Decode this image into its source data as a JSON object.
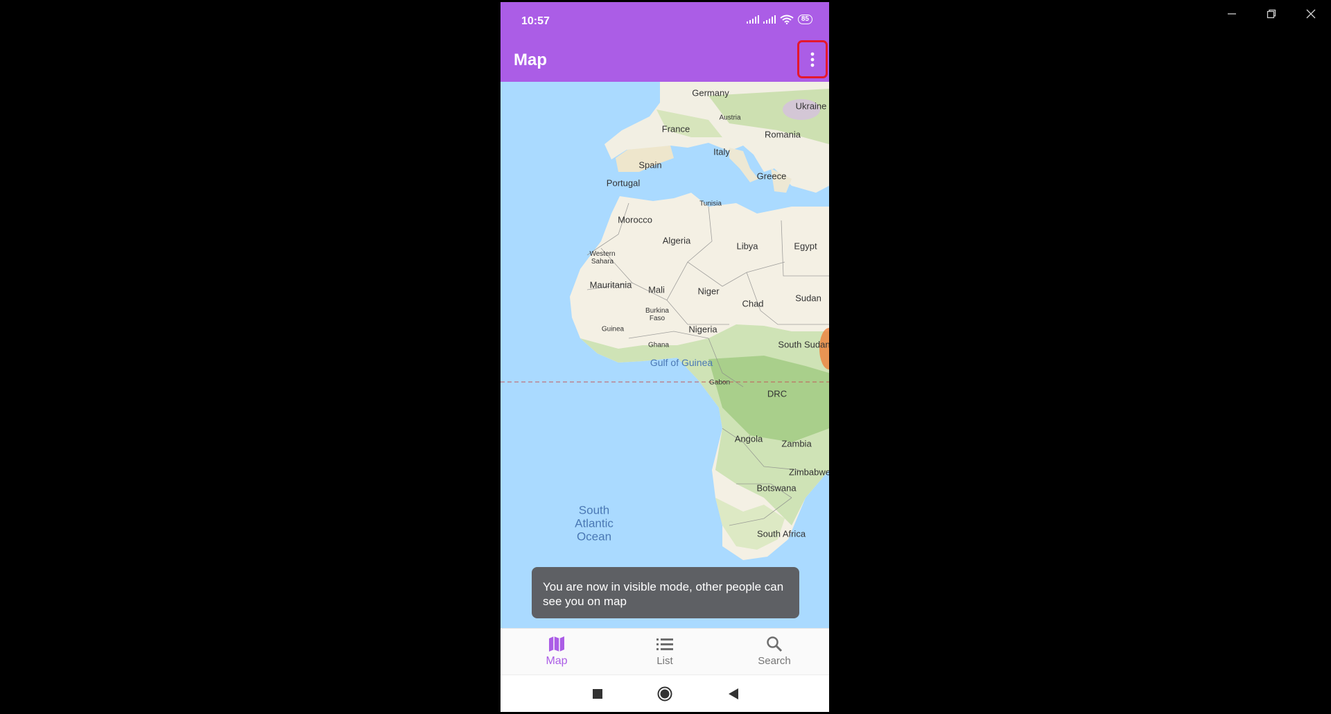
{
  "window": {
    "minimize": "minimize",
    "restore": "restore",
    "close": "close"
  },
  "status_bar": {
    "time": "10:57",
    "battery": "85"
  },
  "app_bar": {
    "title": "Map",
    "menu_icon": "more-vertical-icon"
  },
  "map": {
    "labels": [
      {
        "key": "germany",
        "text": "Germany"
      },
      {
        "key": "austria",
        "text": "Austria"
      },
      {
        "key": "ukraine",
        "text": "Ukraine"
      },
      {
        "key": "france",
        "text": "France"
      },
      {
        "key": "romania",
        "text": "Romania"
      },
      {
        "key": "italy",
        "text": "Italy"
      },
      {
        "key": "spain",
        "text": "Spain"
      },
      {
        "key": "greece",
        "text": "Greece"
      },
      {
        "key": "portugal",
        "text": "Portugal"
      },
      {
        "key": "tunisia",
        "text": "Tunisia"
      },
      {
        "key": "morocco",
        "text": "Morocco"
      },
      {
        "key": "algeria",
        "text": "Algeria"
      },
      {
        "key": "libya",
        "text": "Libya"
      },
      {
        "key": "egypt",
        "text": "Egypt"
      },
      {
        "key": "western_sahara",
        "text": "Western Sahara"
      },
      {
        "key": "mauritania",
        "text": "Mauritania"
      },
      {
        "key": "mali",
        "text": "Mali"
      },
      {
        "key": "niger",
        "text": "Niger"
      },
      {
        "key": "chad",
        "text": "Chad"
      },
      {
        "key": "sudan",
        "text": "Sudan"
      },
      {
        "key": "burkina_faso",
        "text": "Burkina Faso"
      },
      {
        "key": "guinea",
        "text": "Guinea"
      },
      {
        "key": "nigeria",
        "text": "Nigeria"
      },
      {
        "key": "ghana",
        "text": "Ghana"
      },
      {
        "key": "south_sudan",
        "text": "South Sudan"
      },
      {
        "key": "gulf_of_guinea",
        "text": "Gulf of Guinea"
      },
      {
        "key": "gabon",
        "text": "Gabon"
      },
      {
        "key": "drc",
        "text": "DRC"
      },
      {
        "key": "angola",
        "text": "Angola"
      },
      {
        "key": "zambia",
        "text": "Zambia"
      },
      {
        "key": "zimbabwe",
        "text": "Zimbabwe"
      },
      {
        "key": "botswana",
        "text": "Botswana"
      },
      {
        "key": "south_africa",
        "text": "South Africa"
      },
      {
        "key": "south_atlantic_ocean",
        "text": "South Atlantic Ocean"
      }
    ]
  },
  "toast": {
    "message": "You are now in visible mode, other people can see you on map"
  },
  "bottom_nav": {
    "items": [
      {
        "label": "Map",
        "icon": "map-icon",
        "active": true
      },
      {
        "label": "List",
        "icon": "list-icon",
        "active": false
      },
      {
        "label": "Search",
        "icon": "search-icon",
        "active": false
      }
    ]
  },
  "system_nav": {
    "recents": "square-icon",
    "home": "circle-icon",
    "back": "triangle-back-icon"
  },
  "colors": {
    "accent": "#ab5de6",
    "water": "#aadaff",
    "land": "#f4f0e4",
    "forest": "#b9d79c",
    "highlight": "#e5182d"
  }
}
